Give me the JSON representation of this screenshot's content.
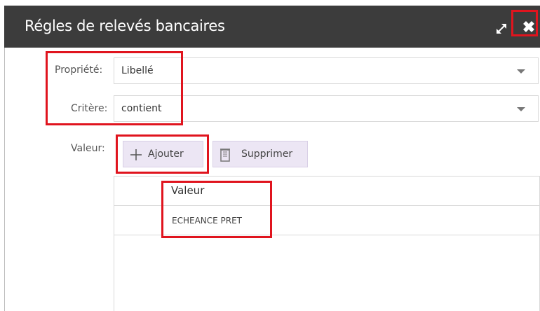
{
  "dialog": {
    "title": "Régles de relevés bancaires",
    "expand_icon": "expand-arrows-icon",
    "close_icon": "close-x-icon",
    "close_glyph": "✖"
  },
  "form": {
    "property_label": "Propriété:",
    "property_value": "Libellé",
    "criteria_label": "Critère:",
    "criteria_value": "contient",
    "value_label": "Valeur:"
  },
  "buttons": {
    "add_label": "Ajouter",
    "add_icon": "plus-icon",
    "delete_label": "Supprimer",
    "delete_icon": "trash-icon"
  },
  "grid": {
    "column_header": "Valeur",
    "rows": [
      "ECHEANCE PRET"
    ]
  },
  "colors": {
    "titlebar": "#3c3c3c",
    "highlight": "#e0141e",
    "button_bg": "#ece6f4"
  }
}
